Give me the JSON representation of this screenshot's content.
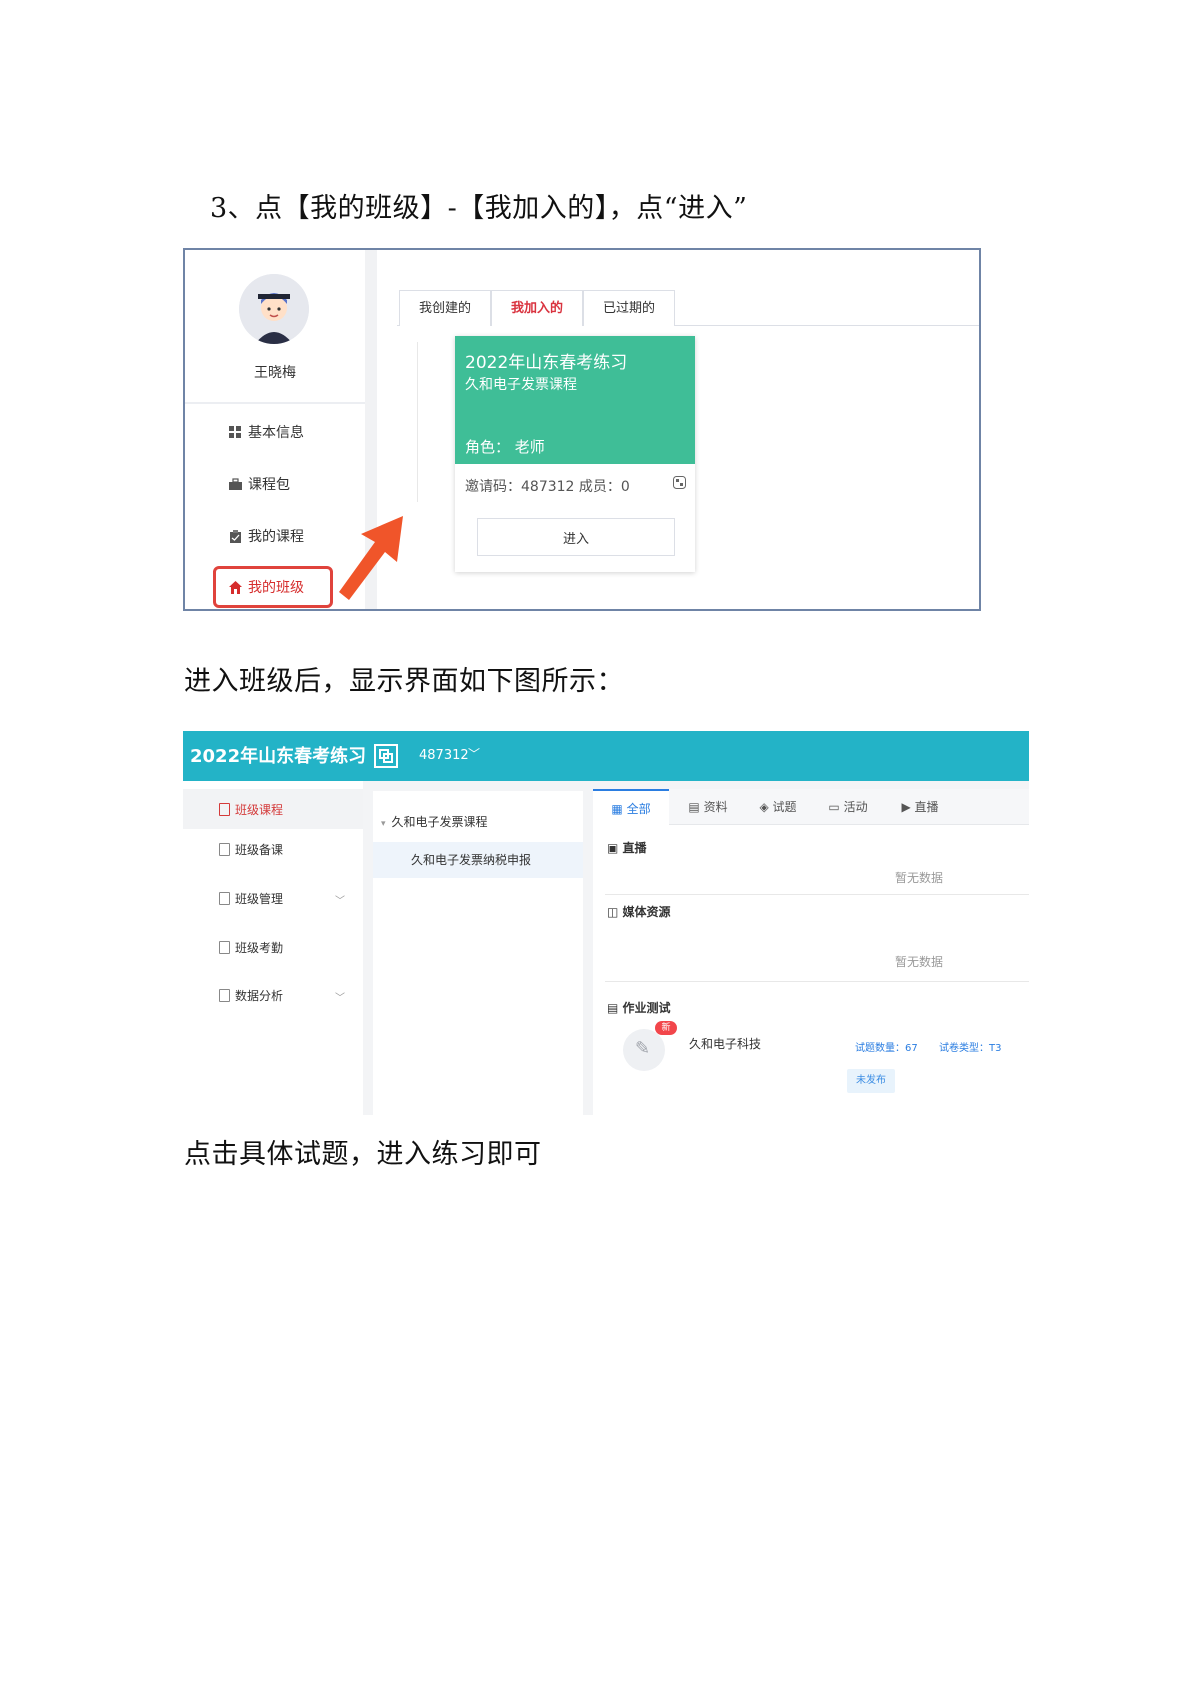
{
  "paragraphs": {
    "step": "3、点【我的班级】-【我加入的】，点“进入”",
    "enter_class": "进入班级后，显示界面如下图所示：",
    "click_question": "点击具体试题，进入练习即可"
  },
  "screenshot1": {
    "user_name": "王晓梅",
    "menu": [
      "基本信息",
      "课程包",
      "我的课程",
      "我的班级"
    ],
    "tabs": [
      "我创建的",
      "我加入的",
      "已过期的"
    ],
    "card": {
      "title": "2022年山东春考练习",
      "subtitle": "久和电子发票课程",
      "role": "角色：  老师",
      "code_members": "邀请码：487312    成员：0",
      "enter_label": "进入"
    },
    "colors": {
      "card_green": "#3fbe97",
      "highlight_red": "#e0433c",
      "arrow": "#f0552a"
    }
  },
  "screenshot2": {
    "header": {
      "title": "2022年山东春考练习",
      "code": "487312",
      "caret": "﹀"
    },
    "left_nav": [
      "班级课程",
      "班级备课",
      "班级管理",
      "班级考勤",
      "数据分析"
    ],
    "tree": {
      "root": "久和电子发票课程",
      "child": "久和电子发票纳税申报"
    },
    "tabs": [
      "全部",
      "资料",
      "试题",
      "活动",
      "直播"
    ],
    "sections": {
      "live": "直播",
      "media": "媒体资源",
      "homework": "作业测试"
    },
    "empty_text": "暂无数据",
    "homework": {
      "badge": "新",
      "name": "久和电子科技",
      "count": "试题数量：67",
      "type": "试卷类型：T3",
      "status": "未发布"
    },
    "colors": {
      "header_teal": "#23b3c7",
      "active_blue": "#2a7de1",
      "active_red": "#d43a3a"
    }
  }
}
